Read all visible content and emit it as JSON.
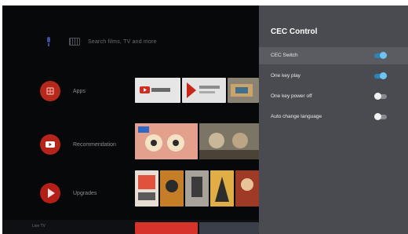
{
  "home": {
    "search_placeholder": "Search films, TV and more",
    "rows": [
      {
        "label": "Apps",
        "icon": "apps-grid-icon",
        "color": "#c8301f"
      },
      {
        "label": "Recommendation",
        "icon": "youtube-icon",
        "color": "#c8261b"
      },
      {
        "label": "Upgrades",
        "icon": "play-store-icon",
        "color": "#c8261b"
      }
    ],
    "bottom_label": "Live TV"
  },
  "panel": {
    "title": "CEC Control",
    "options": [
      {
        "label": "CEC Switch",
        "state": "on",
        "selected": true
      },
      {
        "label": "One key play",
        "state": "on",
        "selected": false
      },
      {
        "label": "One key power off",
        "state": "off",
        "selected": false
      },
      {
        "label": "Auto change language",
        "state": "off",
        "selected": false
      }
    ]
  },
  "colors": {
    "panel_bg": "#4a4b50",
    "toggle_on": "#6fc3ef",
    "toggle_off": "#f2f2f2"
  }
}
